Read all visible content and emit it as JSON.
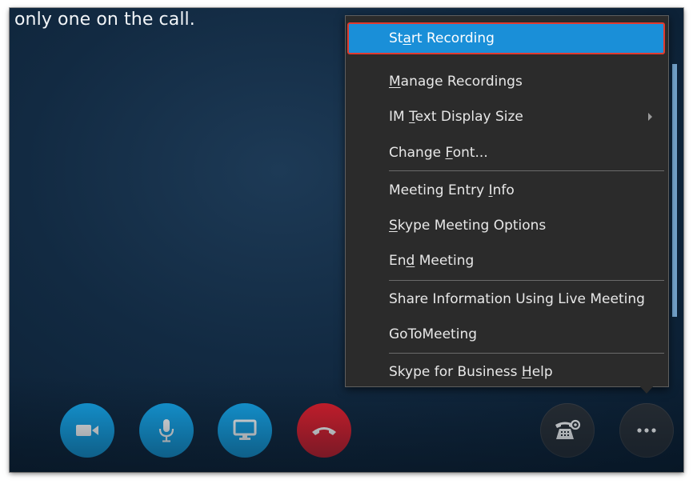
{
  "call": {
    "status_text": "only one on the call."
  },
  "menu": {
    "items": [
      {
        "pre": "St",
        "key": "a",
        "post": "rt Recording"
      },
      {
        "pre": "",
        "key": "M",
        "post": "anage Recordings"
      },
      {
        "pre": "IM ",
        "key": "T",
        "post": "ext Display Size"
      },
      {
        "pre": "Change ",
        "key": "F",
        "post": "ont..."
      },
      {
        "pre": "Meeting Entry ",
        "key": "I",
        "post": "nfo"
      },
      {
        "pre": "",
        "key": "S",
        "post": "kype Meeting Options"
      },
      {
        "pre": "En",
        "key": "d",
        "post": " Meeting"
      },
      {
        "pre": "Share Information Using Live Meeting",
        "key": "",
        "post": ""
      },
      {
        "pre": "GoToMeeting",
        "key": "",
        "post": ""
      },
      {
        "pre": "Skype for Business ",
        "key": "H",
        "post": "elp"
      }
    ]
  },
  "controls": {
    "icons": [
      "video-camera-icon",
      "microphone-icon",
      "screen-share-icon",
      "hang-up-icon",
      "call-controls-icon",
      "more-options-icon"
    ]
  },
  "colors": {
    "highlight": "#1a8fd8",
    "highlight_border": "#e23a2e",
    "button_blue": "#16a3e6",
    "button_red": "#e01f2d",
    "menu_bg": "#2b2b2b"
  }
}
